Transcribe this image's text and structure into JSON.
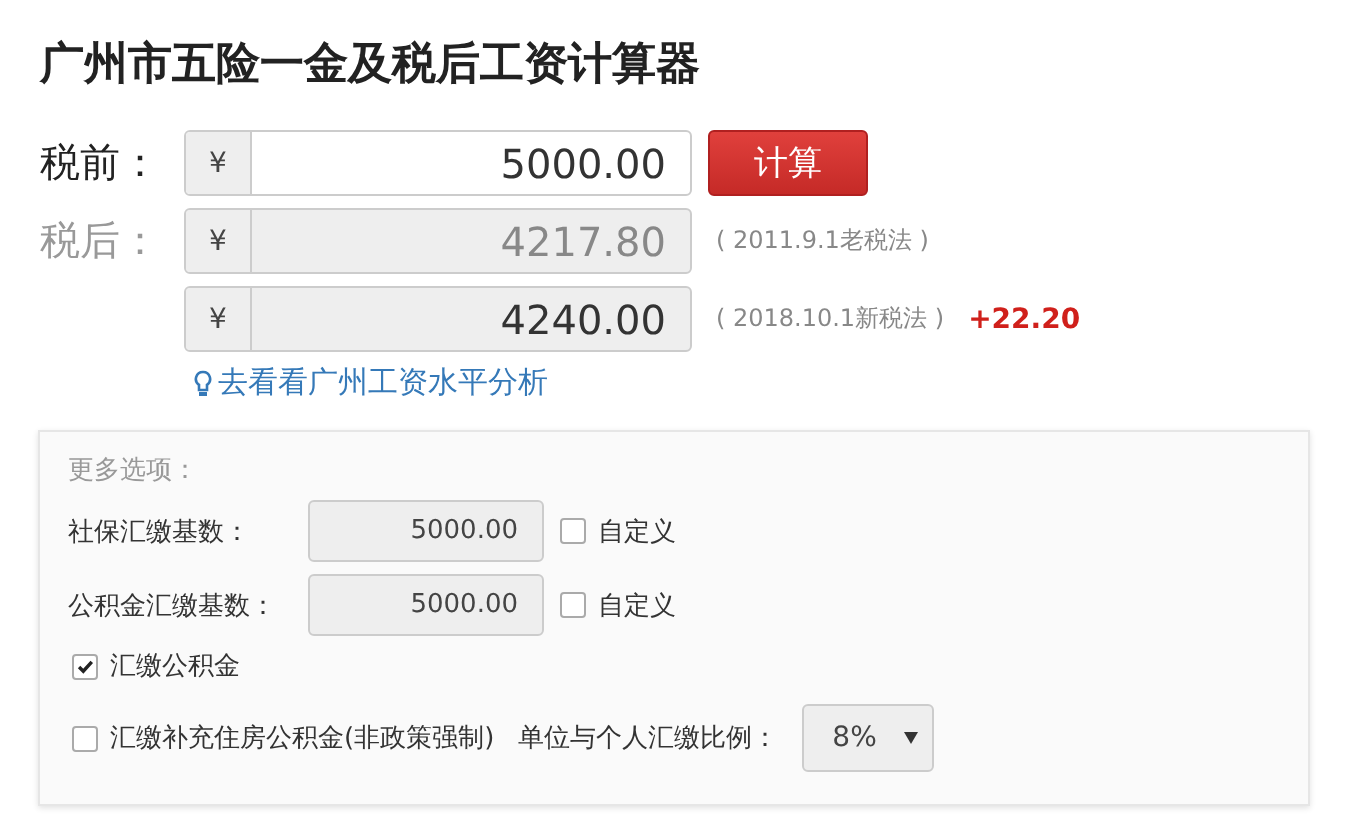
{
  "title": "广州市五险一金及税后工资计算器",
  "pre_tax": {
    "label": "税前：",
    "currency": "¥",
    "value": "5000.00",
    "button": "计算"
  },
  "post_tax": {
    "label": "税后：",
    "results": [
      {
        "currency": "¥",
        "value": "4217.80",
        "note": "( 2011.9.1老税法 )"
      },
      {
        "currency": "¥",
        "value": "4240.00",
        "note": "( 2018.10.1新税法 )",
        "diff": "+22.20"
      }
    ]
  },
  "link": "去看看广州工资水平分析",
  "options": {
    "heading": "更多选项：",
    "bases": [
      {
        "label": "社保汇缴基数：",
        "value": "5000.00",
        "custom_label": "自定义",
        "checked": false
      },
      {
        "label": "公积金汇缴基数：",
        "value": "5000.00",
        "custom_label": "自定义",
        "checked": false
      }
    ],
    "checks": [
      {
        "label": "汇缴公积金",
        "checked": true
      },
      {
        "label": "汇缴补充住房公积金(非政策强制)",
        "checked": false
      }
    ],
    "ratio": {
      "label": "单位与个人汇缴比例：",
      "value": "8%"
    }
  }
}
